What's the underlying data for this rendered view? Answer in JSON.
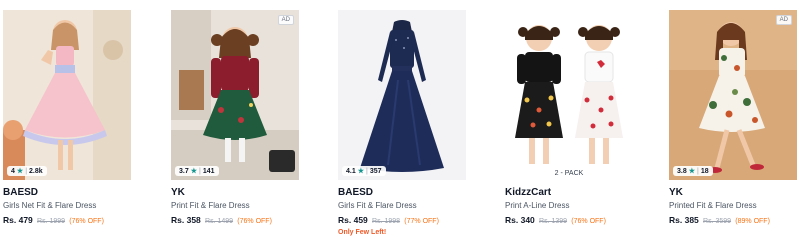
{
  "products": [
    {
      "brand": "BAESD",
      "title": "Girls Net Fit & Flare Dress",
      "price": "Rs. 479",
      "mrp": "Rs. 1999",
      "discount": "(76% OFF)",
      "rating": "4",
      "reviews": "2.8k",
      "ad": "",
      "badge": "",
      "stock": ""
    },
    {
      "brand": "YK",
      "title": "Print Fit & Flare Dress",
      "price": "Rs. 358",
      "mrp": "Rs. 1499",
      "discount": "(76% OFF)",
      "rating": "3.7",
      "reviews": "141",
      "ad": "AD",
      "badge": "",
      "stock": ""
    },
    {
      "brand": "BAESD",
      "title": "Girls Fit & Flare Dress",
      "price": "Rs. 459",
      "mrp": "Rs. 1998",
      "discount": "(77% OFF)",
      "rating": "4.1",
      "reviews": "357",
      "ad": "",
      "badge": "",
      "stock": "Only Few Left!"
    },
    {
      "brand": "KidzzCart",
      "title": "Print A-Line Dress",
      "price": "Rs. 340",
      "mrp": "Rs. 1399",
      "discount": "(76% OFF)",
      "rating": "",
      "reviews": "",
      "ad": "",
      "badge": "2 - PACK",
      "stock": ""
    },
    {
      "brand": "YK",
      "title": "Printed Fit & Flare Dress",
      "price": "Rs. 385",
      "mrp": "Rs. 3599",
      "discount": "(89% OFF)",
      "rating": "3.8",
      "reviews": "18",
      "ad": "AD",
      "badge": "",
      "stock": ""
    }
  ],
  "icons": {
    "rating": "star-icon"
  },
  "colors": {
    "star": "#14958f",
    "discount": "#f97316",
    "stock": "#f05a28"
  }
}
